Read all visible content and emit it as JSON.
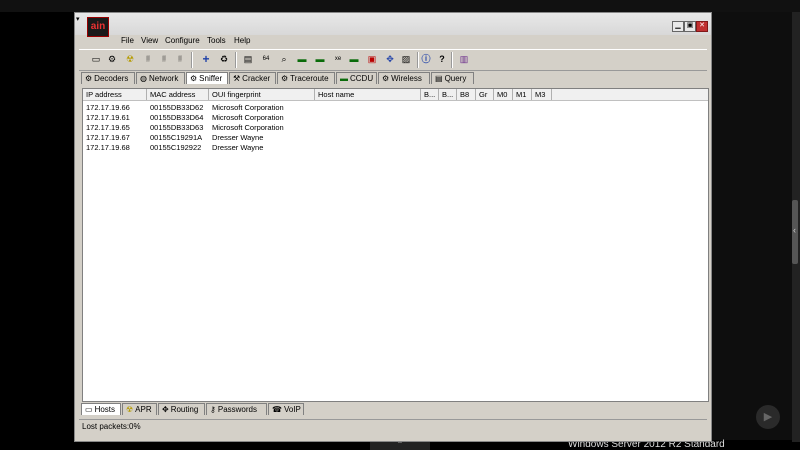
{
  "app": {
    "icon_label": "ain"
  },
  "menu": [
    "File",
    "View",
    "Configure",
    "Tools",
    "Help"
  ],
  "toolbar_icons": [
    "open-folder-icon",
    "network-adapter-icon",
    "radiation-icon",
    "smash-bitcc-icon",
    "smash-bpspoof-icon",
    "smash-bheseb-icon",
    "add-host-icon",
    "clear-icon",
    "certificate-icon",
    "base64-icon",
    "lookup-icon",
    "decoder-icon",
    "password-icon",
    "hash-icon",
    "sniffer-icon",
    "route-icon",
    "image-icon",
    "info-icon",
    "help-icon",
    "compare-icon"
  ],
  "tabs_top": [
    "Decoders",
    "Network",
    "Sniffer",
    "Cracker",
    "Traceroute",
    "CCDU",
    "Wireless",
    "Query"
  ],
  "active_top_tab": "Sniffer",
  "columns": [
    "IP address",
    "MAC address",
    "OUI fingerprint",
    "Host name",
    "B...",
    "B...",
    "B8",
    "Gr",
    "M0",
    "M1",
    "M3"
  ],
  "hosts": [
    {
      "ip": "172.17.19.66",
      "mac": "00155DB33D62",
      "oui": "Microsoft Corporation"
    },
    {
      "ip": "172.17.19.61",
      "mac": "00155DB33D64",
      "oui": "Microsoft Corporation"
    },
    {
      "ip": "172.17.19.65",
      "mac": "00155DB33D63",
      "oui": "Microsoft Corporation"
    },
    {
      "ip": "172.17.19.67",
      "mac": "00155C19291A",
      "oui": "Dresser Wayne"
    },
    {
      "ip": "172.17.19.68",
      "mac": "00155C192922",
      "oui": "Dresser Wayne"
    }
  ],
  "tabs_bottom": [
    "Hosts",
    "APR",
    "Routing",
    "Passwords",
    "VoIP"
  ],
  "active_bottom_tab": "Hosts",
  "status": {
    "label": "Lost packets:",
    "value": "0%"
  },
  "taskbar": {
    "text": "Windows Server 2012 R2 Standard"
  },
  "colors": {
    "accent": "#c03030",
    "window_bg": "#d4d0c8",
    "list_bg": "#ffffff"
  }
}
